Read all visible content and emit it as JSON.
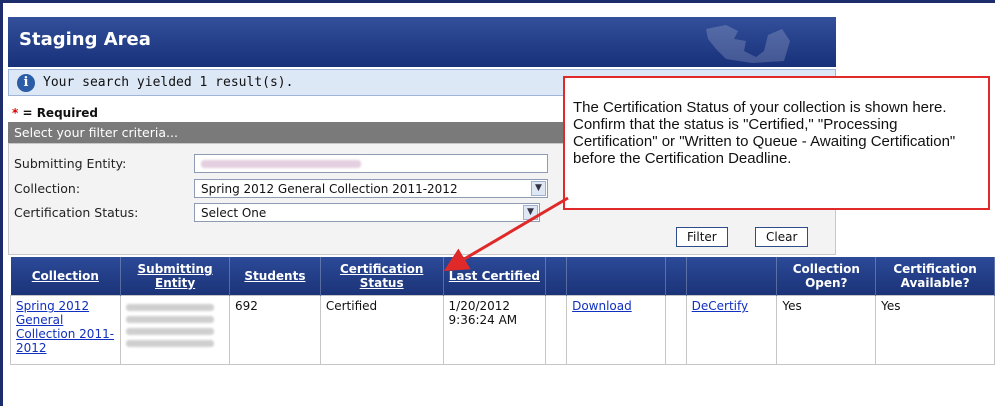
{
  "header": {
    "title": "Staging Area"
  },
  "search": {
    "result_text": "Your search yielded 1 result(s)."
  },
  "required_legend": {
    "star": "*",
    "text": " = Required"
  },
  "filter": {
    "bar_text": "Select your filter criteria...",
    "submitting_entity_label": "Submitting Entity:",
    "collection_label": "Collection:",
    "collection_value": "Spring 2012 General Collection 2011-2012",
    "status_label": "Certification Status:",
    "status_value": "Select One",
    "filter_button": "Filter",
    "clear_button": "Clear"
  },
  "table": {
    "headers": {
      "collection": "Collection",
      "submitting_entity": "Submitting Entity",
      "students": "Students",
      "certification_status": "Certification Status",
      "last_certified": "Last Certified",
      "collection_open": "Collection Open?",
      "certification_available": "Certification Available?"
    },
    "row": {
      "collection": "Spring 2012 General Collection 2011-2012",
      "students": "692",
      "status": "Certified",
      "last_certified": "1/20/2012 9:36:24 AM",
      "download": "Download",
      "decertify": "DeCertify",
      "open": "Yes",
      "available": "Yes"
    }
  },
  "callout": {
    "text": "The Certification Status of your collection is shown here. Confirm that the status is \"Certified,\" \"Processing Certification\" or \"Written to Queue - Awaiting Certification\" before the Certification Deadline."
  },
  "colors": {
    "header": "#17307a",
    "callout_border": "#e02a2a",
    "link": "#1030c0"
  }
}
